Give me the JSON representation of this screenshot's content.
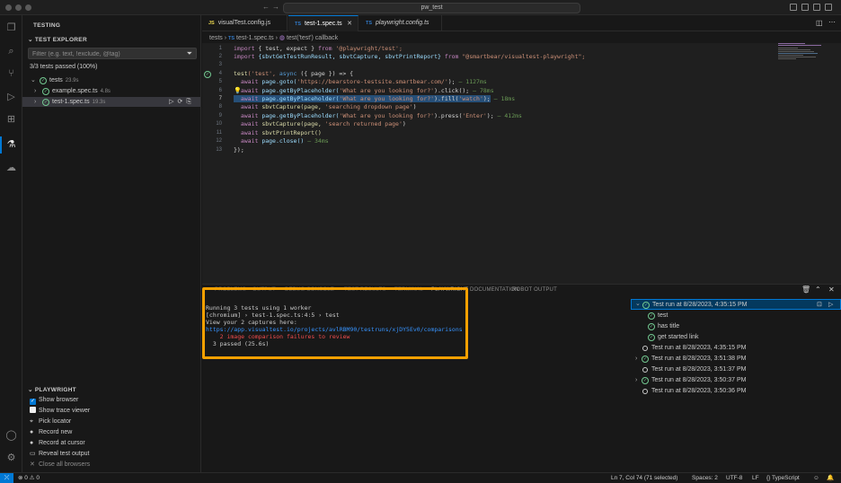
{
  "window": {
    "title": "pw_test"
  },
  "sidebar": {
    "title": "TESTING",
    "explorer_heading": "TEST EXPLORER",
    "filter_placeholder": "Filter (e.g. text, !exclude, @tag)",
    "summary": "3/3 tests passed (100%)",
    "tree": [
      {
        "label": "tests",
        "duration": "23.9s",
        "expanded": true
      },
      {
        "label": "example.spec.ts",
        "duration": "4.8s"
      },
      {
        "label": "test-1.spec.ts",
        "duration": "19.3s",
        "selected": true
      }
    ],
    "playwright": {
      "heading": "PLAYWRIGHT",
      "show_browser": "Show browser",
      "show_trace_viewer": "Show trace viewer",
      "actions": [
        "Pick locator",
        "Record new",
        "Record at cursor",
        "Reveal test output",
        "Close all browsers"
      ]
    }
  },
  "tabs": [
    {
      "label": "visualTest.config.js",
      "type": "JS"
    },
    {
      "label": "test-1.spec.ts",
      "type": "TS",
      "active": true
    },
    {
      "label": "playwright.config.ts",
      "type": "TS"
    }
  ],
  "breadcrumb": {
    "folder": "tests",
    "file": "test-1.spec.ts",
    "symbol": "test('test') callback"
  },
  "editor": {
    "line_numbers": [
      "1",
      "2",
      "3",
      "4",
      "5",
      "6",
      "7",
      "8",
      "9",
      "10",
      "11",
      "12",
      "13"
    ],
    "l1": {
      "a": "import",
      "b": " { test, expect } ",
      "c": "from",
      "d": " '@playwright/test';"
    },
    "l2": {
      "a": "import",
      "b": " {sbvtGetTestRunResult, sbvtCapture, sbvtPrintReport} ",
      "c": "from",
      "d": " \"@smartbear/visualtest-playwright\";"
    },
    "l4": {
      "a": "test",
      "b": "('test', ",
      "c": "async",
      "d": " ({ page }) => {"
    },
    "l5": {
      "a": "  await ",
      "b": "page.goto(",
      "c": "'https://bearstore-testsite.smartbear.com/'",
      "d": ");",
      "e": " — 1127ms"
    },
    "l6": {
      "a": "  await ",
      "b": "page.getByPlaceholder(",
      "c": "'What are you looking for?'",
      "d": ").click();",
      "e": " — 78ms"
    },
    "l7": {
      "a": "  await ",
      "b": "page.getByPlaceholder(",
      "c": "'What are you looking for?'",
      "d": ").fill(",
      "f": "'watch'",
      "g": ");",
      "e": " — 18ms"
    },
    "l8": {
      "a": "  await ",
      "b": "sbvtCapture(page, ",
      "c": "'searching dropdown page'",
      "d": ")"
    },
    "l9": {
      "a": "  await ",
      "b": "page.getByPlaceholder(",
      "c": "'What are you looking for?'",
      "d": ").press(",
      "f": "'Enter'",
      "g": ");",
      "e": " — 412ms"
    },
    "l10": {
      "a": "  await ",
      "b": "sbvtCapture(page, ",
      "c": "'search returned page'",
      "d": ")"
    },
    "l11": {
      "a": "  await ",
      "b": "sbvtPrintReport()"
    },
    "l12": {
      "a": "  await ",
      "b": "page.close()",
      "e": " — 34ms"
    },
    "l13": {
      "a": "});"
    }
  },
  "panel": {
    "tabs": [
      "PROBLEMS",
      "OUTPUT",
      "DEBUG CONSOLE",
      "TEST RESULTS",
      "TERMINAL",
      "PLAYWRIGHT DOCUMENTATION",
      "ROBOT OUTPUT"
    ],
    "terminal": [
      "Running 3 tests using 1 worker",
      "[chromium] › test-1.spec.ts:4:5 › test",
      "View your 2 captures here:",
      "https://app.visualtest.io/projects/avlRBM90/testruns/xjDY5Ev0/comparisons",
      "    2 image comparison failures to review",
      "  3 passed (25.6s)"
    ],
    "runs": [
      {
        "label": "Test run at 8/28/2023, 4:35:15 PM",
        "expanded": true
      },
      {
        "label": "test"
      },
      {
        "label": "has title"
      },
      {
        "label": "get started link"
      },
      {
        "label": "Test run at 8/28/2023, 4:35:15 PM"
      },
      {
        "label": "Test run at 8/28/2023, 3:51:38 PM"
      },
      {
        "label": "Test run at 8/28/2023, 3:51:37 PM"
      },
      {
        "label": "Test run at 8/28/2023, 3:50:37 PM"
      },
      {
        "label": "Test run at 8/28/2023, 3:50:36 PM"
      }
    ]
  },
  "statusbar": {
    "problems": "0 ⚠ 0",
    "cursor": "Ln 7, Col 74 (71 selected)",
    "spaces": "Spaces: 2",
    "encoding": "UTF-8",
    "eol": "LF",
    "language": "{} TypeScript"
  },
  "colors": {
    "accent": "#0078d4",
    "pass": "#73c991",
    "highlight_box": "#f5a000"
  }
}
